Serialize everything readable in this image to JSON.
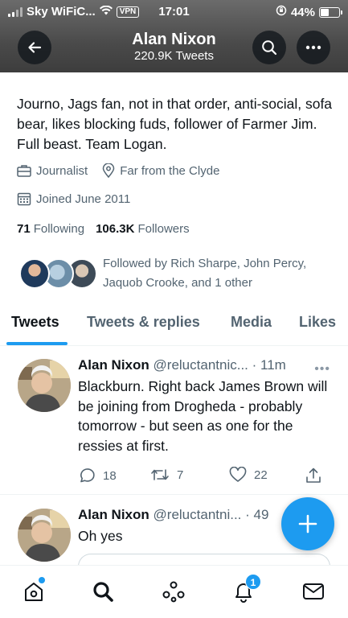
{
  "status_bar": {
    "carrier": "Sky WiFiC...",
    "vpn": "VPN",
    "time": "17:01",
    "battery": "44%"
  },
  "header": {
    "name": "Alan Nixon",
    "tweet_count": "220.9K Tweets"
  },
  "profile": {
    "bio": "Journo, Jags fan, not in that order, anti-social, sofa bear, likes blocking fuds, follower of Farmer Jim. Full beast. Team Logan.",
    "profession": "Journalist",
    "location": "Far from the Clyde",
    "joined": "Joined June 2011",
    "following_count": "71",
    "following_label": "Following",
    "followers_count": "106.3K",
    "followers_label": "Followers",
    "followed_by": "Followed by Rich Sharpe, John Percy, Jaquob Crooke, and 1 other"
  },
  "tabs": [
    {
      "label": "Tweets"
    },
    {
      "label": "Tweets & replies"
    },
    {
      "label": "Media"
    },
    {
      "label": "Likes"
    }
  ],
  "tweets": [
    {
      "name": "Alan Nixon",
      "handle_time": "@reluctantnic... · 11m",
      "text": "Blackburn. Right back James Brown will be joining from Drogheda - probably tomorrow - but seen as one for the ressies at first.",
      "replies": "18",
      "retweets": "7",
      "likes": "22"
    },
    {
      "name": "Alan Nixon",
      "handle_time": "@reluctantni... · 49",
      "text": "Oh yes"
    }
  ],
  "nav": {
    "notification_badge": "1"
  },
  "colors": {
    "accent": "#1d9bf0",
    "text": "#0f1419",
    "secondary_text": "#536471"
  }
}
